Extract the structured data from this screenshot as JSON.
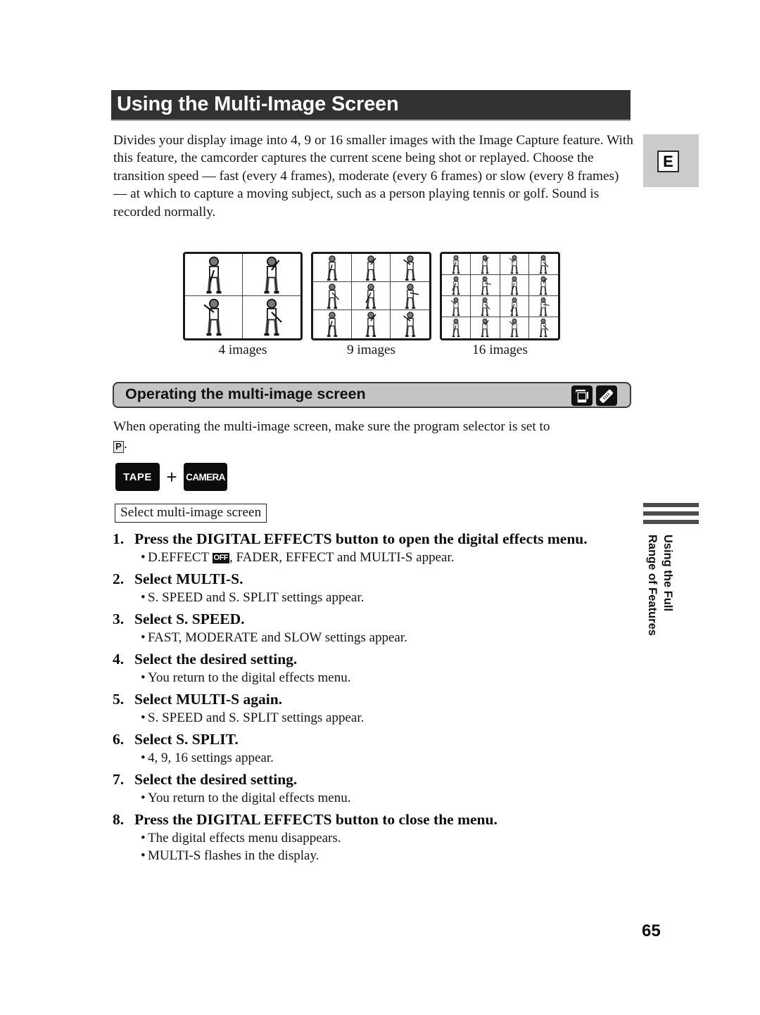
{
  "page": {
    "title": "Using the Multi-Image Screen",
    "language_tab": "E",
    "intro": "Divides your display image into 4, 9 or 16 smaller images with the Image Capture feature. With this feature, the camcorder captures the current scene being shot or replayed. Choose the transition speed — fast (every 4 frames), moderate (every 6 frames) or slow (every 8 frames) — at which to capture a moving subject, such as a person playing tennis or golf. Sound is recorded normally.",
    "page_number": "65"
  },
  "illustrations": [
    {
      "caption": "4 images",
      "count": 4,
      "icon": "golfer-swing-sequence"
    },
    {
      "caption": "9 images",
      "count": 9,
      "icon": "golfer-swing-sequence"
    },
    {
      "caption": "16 images",
      "count": 16,
      "icon": "golfer-swing-sequence"
    }
  ],
  "section": {
    "title": "Operating the multi-image screen",
    "icons": [
      "camcorder-body-icon",
      "remote-control-icon"
    ],
    "note_prefix": "When operating the multi-image screen, make sure the program selector is set to",
    "program_mode": "P",
    "note_suffix": "."
  },
  "mode": {
    "tape_label": "TAPE",
    "plus": "+",
    "camera_label": "CAMERA",
    "select_label": "Select multi-image screen"
  },
  "steps": [
    {
      "num": "1.",
      "title": "Press the DIGITAL EFFECTS button to open the digital effects menu.",
      "bullets": [
        {
          "before": "D.EFFECT ",
          "badge": "OFF",
          "after": ", FADER, EFFECT and MULTI-S appear."
        }
      ]
    },
    {
      "num": "2.",
      "title": "Select MULTI-S.",
      "bullets": [
        {
          "before": "S. SPEED and S. SPLIT settings appear."
        }
      ]
    },
    {
      "num": "3.",
      "title": "Select S. SPEED.",
      "bullets": [
        {
          "before": "FAST, MODERATE and SLOW settings appear."
        }
      ]
    },
    {
      "num": "4.",
      "title": "Select the desired setting.",
      "bullets": [
        {
          "before": "You return to the digital effects menu."
        }
      ]
    },
    {
      "num": "5.",
      "title": "Select MULTI-S again.",
      "bullets": [
        {
          "before": "S. SPEED and S. SPLIT settings appear."
        }
      ]
    },
    {
      "num": "6.",
      "title": "Select S. SPLIT.",
      "bullets": [
        {
          "before": "4, 9, 16 settings appear."
        }
      ]
    },
    {
      "num": "7.",
      "title": "Select the desired setting.",
      "bullets": [
        {
          "before": "You return to the digital effects menu."
        }
      ]
    },
    {
      "num": "8.",
      "title": "Press the DIGITAL EFFECTS button to close the menu.",
      "bullets": [
        {
          "before": "The digital effects menu disappears."
        },
        {
          "before": "MULTI-S flashes in the display."
        }
      ]
    }
  ],
  "sidebar": {
    "chapter_line1": "Using the Full",
    "chapter_line2": "Range of Features"
  },
  "bullet_glyph": "•"
}
